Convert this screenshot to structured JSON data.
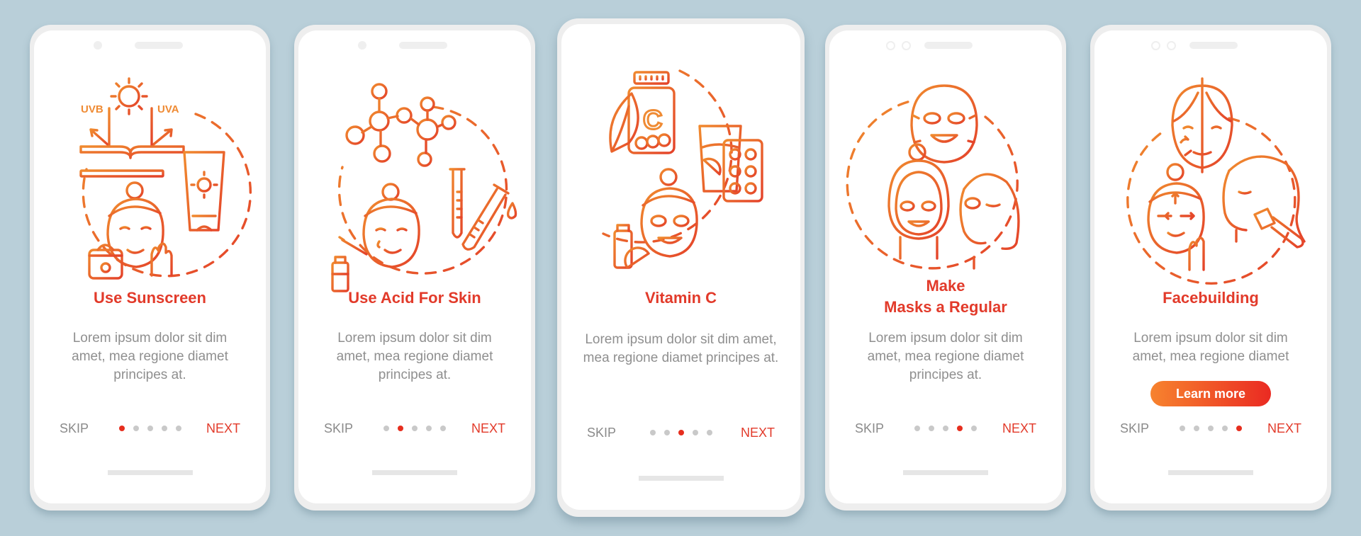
{
  "theme": {
    "background": "#b9cfd9",
    "accent": "#e23a2a",
    "active_dot": "#e62e1e",
    "inactive_dot": "#c9c9c9",
    "body_text": "#8f8f8f",
    "illustration_gradient": [
      "#f08a2e",
      "#e4422a"
    ],
    "button_gradient": [
      "#f7832e",
      "#ea2a22"
    ]
  },
  "screens": [
    {
      "title": "Use Sunscreen",
      "body": "Lorem ipsum dolor sit dim amet, mea regione diamet principes at.",
      "illustration": "sunscreen-illustration",
      "illustration_labels": {
        "left": "UVB",
        "right": "UVA"
      },
      "skip_label": "SKIP",
      "next_label": "NEXT",
      "page_index": 1,
      "page_count": 5
    },
    {
      "title": "Use Acid For Skin",
      "body": "Lorem ipsum dolor sit dim amet, mea regione diamet principes at.",
      "illustration": "acid-skin-illustration",
      "skip_label": "SKIP",
      "next_label": "NEXT",
      "page_index": 2,
      "page_count": 5
    },
    {
      "title": "Vitamin C",
      "body": "Lorem ipsum dolor sit dim amet, mea regione diamet principes at.",
      "illustration": "vitamin-c-illustration",
      "illustration_labels": {
        "jar": "C"
      },
      "skip_label": "SKIP",
      "next_label": "NEXT",
      "page_index": 3,
      "page_count": 5
    },
    {
      "title_line1": "Make",
      "title_line2": "Masks a Regular",
      "body": "Lorem ipsum dolor sit dim amet, mea regione diamet principes at.",
      "illustration": "face-masks-illustration",
      "skip_label": "SKIP",
      "next_label": "NEXT",
      "page_index": 4,
      "page_count": 5
    },
    {
      "title": "Facebuilding",
      "body": "Lorem ipsum dolor sit dim amet, mea regione diamet",
      "illustration": "facebuilding-illustration",
      "button_label": "Learn more",
      "skip_label": "SKIP",
      "next_label": "NEXT",
      "page_index": 5,
      "page_count": 5
    }
  ]
}
